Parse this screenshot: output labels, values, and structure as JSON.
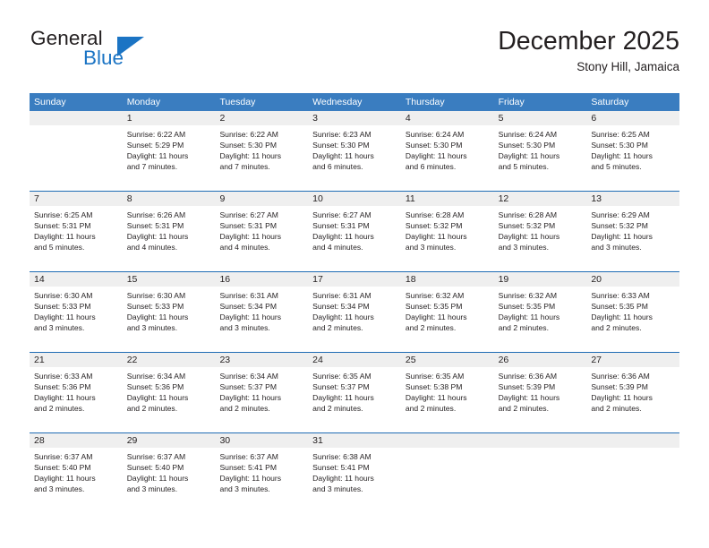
{
  "brand": {
    "name_part1": "General",
    "name_part2": "Blue",
    "logo_icon": "triangle-icon",
    "accent_color": "#1b74c4"
  },
  "header": {
    "title": "December 2025",
    "subtitle": "Stony Hill, Jamaica"
  },
  "calendar": {
    "header_bg": "#3a7dc0",
    "daynum_bg": "#efefef",
    "row_rule_color": "#1f6cb4",
    "weekday_headers": [
      "Sunday",
      "Monday",
      "Tuesday",
      "Wednesday",
      "Thursday",
      "Friday",
      "Saturday"
    ],
    "weeks": [
      [
        {
          "day": "",
          "sunrise": "",
          "sunset": "",
          "daylight_line1": "",
          "daylight_line2": ""
        },
        {
          "day": "1",
          "sunrise": "Sunrise: 6:22 AM",
          "sunset": "Sunset: 5:29 PM",
          "daylight_line1": "Daylight: 11 hours",
          "daylight_line2": "and 7 minutes."
        },
        {
          "day": "2",
          "sunrise": "Sunrise: 6:22 AM",
          "sunset": "Sunset: 5:30 PM",
          "daylight_line1": "Daylight: 11 hours",
          "daylight_line2": "and 7 minutes."
        },
        {
          "day": "3",
          "sunrise": "Sunrise: 6:23 AM",
          "sunset": "Sunset: 5:30 PM",
          "daylight_line1": "Daylight: 11 hours",
          "daylight_line2": "and 6 minutes."
        },
        {
          "day": "4",
          "sunrise": "Sunrise: 6:24 AM",
          "sunset": "Sunset: 5:30 PM",
          "daylight_line1": "Daylight: 11 hours",
          "daylight_line2": "and 6 minutes."
        },
        {
          "day": "5",
          "sunrise": "Sunrise: 6:24 AM",
          "sunset": "Sunset: 5:30 PM",
          "daylight_line1": "Daylight: 11 hours",
          "daylight_line2": "and 5 minutes."
        },
        {
          "day": "6",
          "sunrise": "Sunrise: 6:25 AM",
          "sunset": "Sunset: 5:30 PM",
          "daylight_line1": "Daylight: 11 hours",
          "daylight_line2": "and 5 minutes."
        }
      ],
      [
        {
          "day": "7",
          "sunrise": "Sunrise: 6:25 AM",
          "sunset": "Sunset: 5:31 PM",
          "daylight_line1": "Daylight: 11 hours",
          "daylight_line2": "and 5 minutes."
        },
        {
          "day": "8",
          "sunrise": "Sunrise: 6:26 AM",
          "sunset": "Sunset: 5:31 PM",
          "daylight_line1": "Daylight: 11 hours",
          "daylight_line2": "and 4 minutes."
        },
        {
          "day": "9",
          "sunrise": "Sunrise: 6:27 AM",
          "sunset": "Sunset: 5:31 PM",
          "daylight_line1": "Daylight: 11 hours",
          "daylight_line2": "and 4 minutes."
        },
        {
          "day": "10",
          "sunrise": "Sunrise: 6:27 AM",
          "sunset": "Sunset: 5:31 PM",
          "daylight_line1": "Daylight: 11 hours",
          "daylight_line2": "and 4 minutes."
        },
        {
          "day": "11",
          "sunrise": "Sunrise: 6:28 AM",
          "sunset": "Sunset: 5:32 PM",
          "daylight_line1": "Daylight: 11 hours",
          "daylight_line2": "and 3 minutes."
        },
        {
          "day": "12",
          "sunrise": "Sunrise: 6:28 AM",
          "sunset": "Sunset: 5:32 PM",
          "daylight_line1": "Daylight: 11 hours",
          "daylight_line2": "and 3 minutes."
        },
        {
          "day": "13",
          "sunrise": "Sunrise: 6:29 AM",
          "sunset": "Sunset: 5:32 PM",
          "daylight_line1": "Daylight: 11 hours",
          "daylight_line2": "and 3 minutes."
        }
      ],
      [
        {
          "day": "14",
          "sunrise": "Sunrise: 6:30 AM",
          "sunset": "Sunset: 5:33 PM",
          "daylight_line1": "Daylight: 11 hours",
          "daylight_line2": "and 3 minutes."
        },
        {
          "day": "15",
          "sunrise": "Sunrise: 6:30 AM",
          "sunset": "Sunset: 5:33 PM",
          "daylight_line1": "Daylight: 11 hours",
          "daylight_line2": "and 3 minutes."
        },
        {
          "day": "16",
          "sunrise": "Sunrise: 6:31 AM",
          "sunset": "Sunset: 5:34 PM",
          "daylight_line1": "Daylight: 11 hours",
          "daylight_line2": "and 3 minutes."
        },
        {
          "day": "17",
          "sunrise": "Sunrise: 6:31 AM",
          "sunset": "Sunset: 5:34 PM",
          "daylight_line1": "Daylight: 11 hours",
          "daylight_line2": "and 2 minutes."
        },
        {
          "day": "18",
          "sunrise": "Sunrise: 6:32 AM",
          "sunset": "Sunset: 5:35 PM",
          "daylight_line1": "Daylight: 11 hours",
          "daylight_line2": "and 2 minutes."
        },
        {
          "day": "19",
          "sunrise": "Sunrise: 6:32 AM",
          "sunset": "Sunset: 5:35 PM",
          "daylight_line1": "Daylight: 11 hours",
          "daylight_line2": "and 2 minutes."
        },
        {
          "day": "20",
          "sunrise": "Sunrise: 6:33 AM",
          "sunset": "Sunset: 5:35 PM",
          "daylight_line1": "Daylight: 11 hours",
          "daylight_line2": "and 2 minutes."
        }
      ],
      [
        {
          "day": "21",
          "sunrise": "Sunrise: 6:33 AM",
          "sunset": "Sunset: 5:36 PM",
          "daylight_line1": "Daylight: 11 hours",
          "daylight_line2": "and 2 minutes."
        },
        {
          "day": "22",
          "sunrise": "Sunrise: 6:34 AM",
          "sunset": "Sunset: 5:36 PM",
          "daylight_line1": "Daylight: 11 hours",
          "daylight_line2": "and 2 minutes."
        },
        {
          "day": "23",
          "sunrise": "Sunrise: 6:34 AM",
          "sunset": "Sunset: 5:37 PM",
          "daylight_line1": "Daylight: 11 hours",
          "daylight_line2": "and 2 minutes."
        },
        {
          "day": "24",
          "sunrise": "Sunrise: 6:35 AM",
          "sunset": "Sunset: 5:37 PM",
          "daylight_line1": "Daylight: 11 hours",
          "daylight_line2": "and 2 minutes."
        },
        {
          "day": "25",
          "sunrise": "Sunrise: 6:35 AM",
          "sunset": "Sunset: 5:38 PM",
          "daylight_line1": "Daylight: 11 hours",
          "daylight_line2": "and 2 minutes."
        },
        {
          "day": "26",
          "sunrise": "Sunrise: 6:36 AM",
          "sunset": "Sunset: 5:39 PM",
          "daylight_line1": "Daylight: 11 hours",
          "daylight_line2": "and 2 minutes."
        },
        {
          "day": "27",
          "sunrise": "Sunrise: 6:36 AM",
          "sunset": "Sunset: 5:39 PM",
          "daylight_line1": "Daylight: 11 hours",
          "daylight_line2": "and 2 minutes."
        }
      ],
      [
        {
          "day": "28",
          "sunrise": "Sunrise: 6:37 AM",
          "sunset": "Sunset: 5:40 PM",
          "daylight_line1": "Daylight: 11 hours",
          "daylight_line2": "and 3 minutes."
        },
        {
          "day": "29",
          "sunrise": "Sunrise: 6:37 AM",
          "sunset": "Sunset: 5:40 PM",
          "daylight_line1": "Daylight: 11 hours",
          "daylight_line2": "and 3 minutes."
        },
        {
          "day": "30",
          "sunrise": "Sunrise: 6:37 AM",
          "sunset": "Sunset: 5:41 PM",
          "daylight_line1": "Daylight: 11 hours",
          "daylight_line2": "and 3 minutes."
        },
        {
          "day": "31",
          "sunrise": "Sunrise: 6:38 AM",
          "sunset": "Sunset: 5:41 PM",
          "daylight_line1": "Daylight: 11 hours",
          "daylight_line2": "and 3 minutes."
        },
        {
          "day": "",
          "sunrise": "",
          "sunset": "",
          "daylight_line1": "",
          "daylight_line2": ""
        },
        {
          "day": "",
          "sunrise": "",
          "sunset": "",
          "daylight_line1": "",
          "daylight_line2": ""
        },
        {
          "day": "",
          "sunrise": "",
          "sunset": "",
          "daylight_line1": "",
          "daylight_line2": ""
        }
      ]
    ]
  }
}
